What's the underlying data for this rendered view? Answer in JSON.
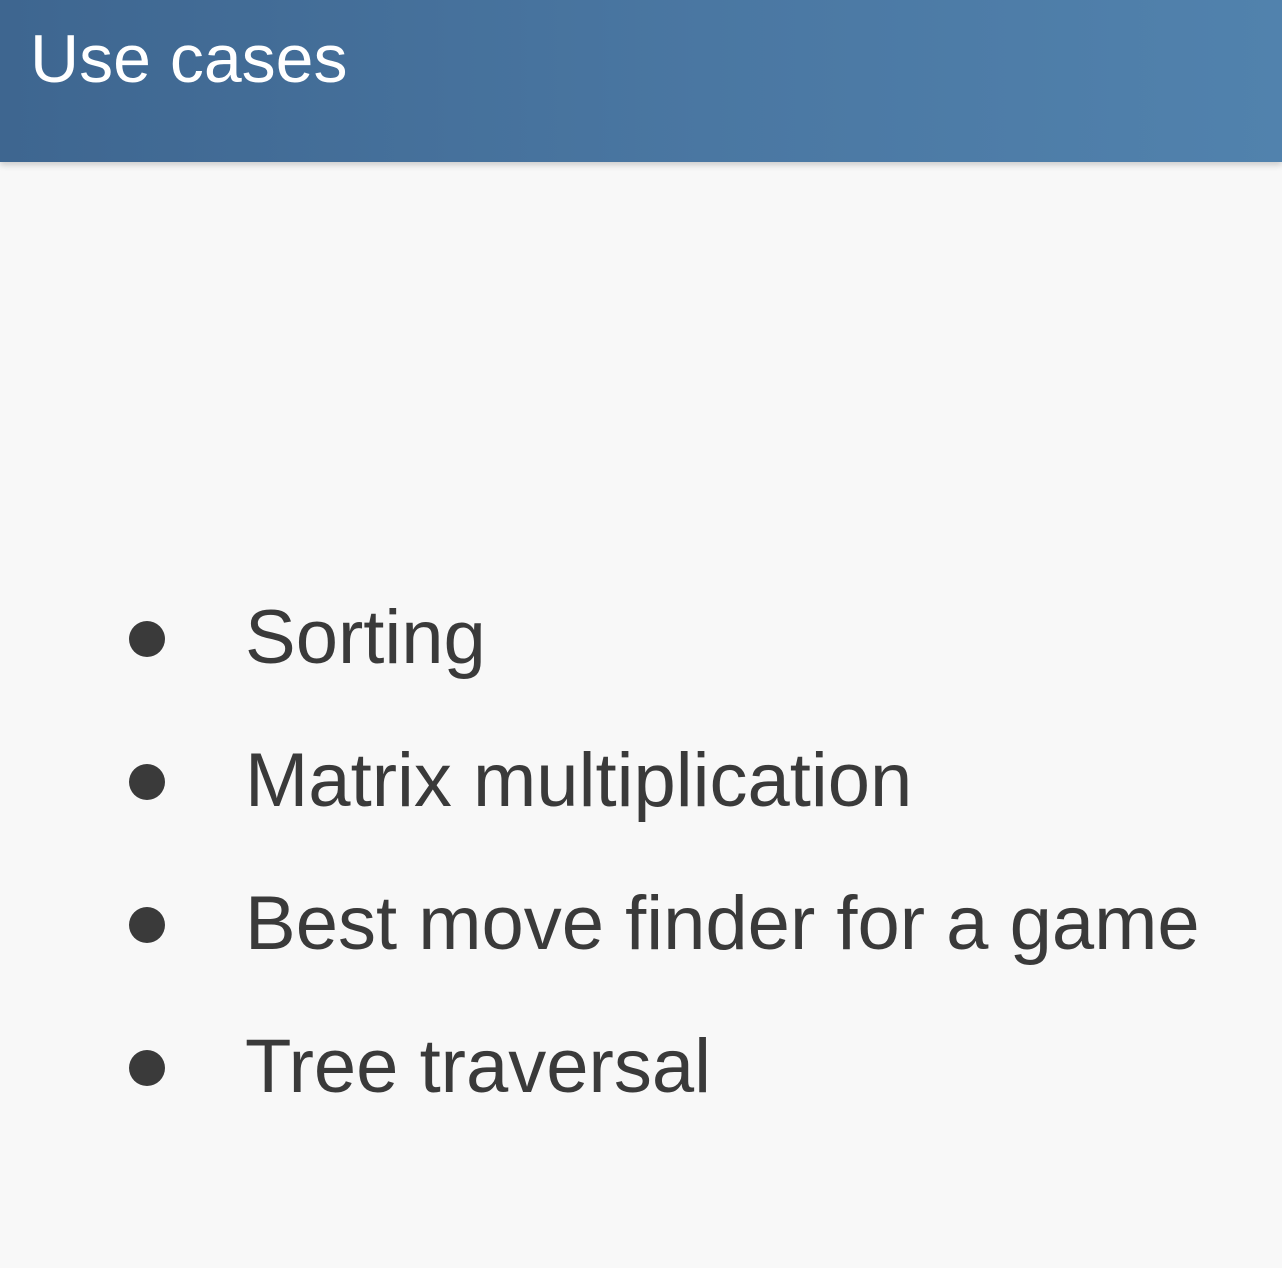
{
  "header": {
    "title": "Use cases"
  },
  "list": {
    "items": [
      {
        "text": "Sorting"
      },
      {
        "text": "Matrix multiplication"
      },
      {
        "text": "Best move finder for a game"
      },
      {
        "text": "Tree traversal"
      }
    ]
  },
  "colors": {
    "header_background": "#4a77a2",
    "header_text": "#ffffff",
    "page_background": "#f8f8f8",
    "body_text": "#3a3a3a"
  }
}
